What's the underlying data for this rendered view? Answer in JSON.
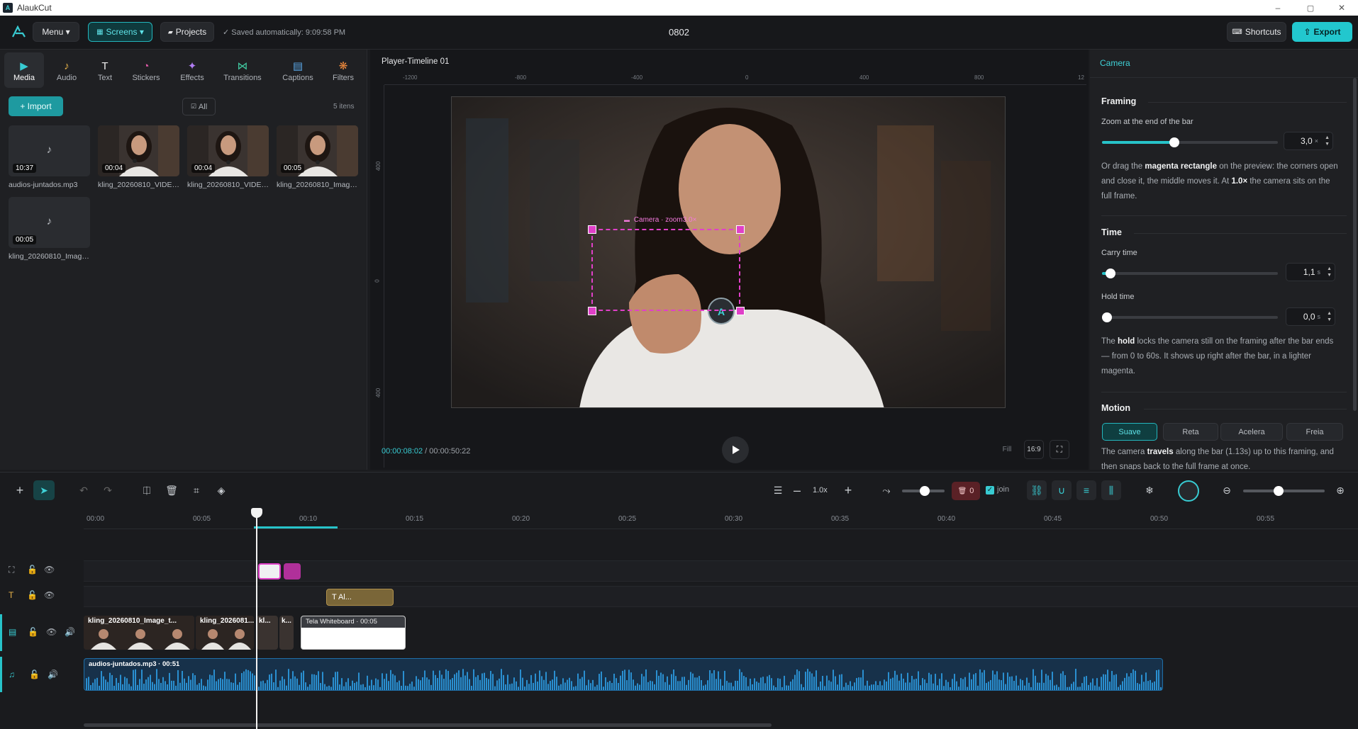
{
  "window": {
    "app_title": "AlaukCut",
    "minimize": "–",
    "maximize": "▢",
    "close": "✕",
    "logo_text": "A"
  },
  "topbar": {
    "menu_label": "Menu ▾",
    "screens_label": "Screens ▾",
    "projects_label": "Projects",
    "saved_status": "✓ Saved automatically: 9:09:58 PM",
    "project_name": "0802",
    "shortcuts_label": "Shortcuts",
    "export_label": "Export"
  },
  "left_panel": {
    "tabs": [
      {
        "label": "Media",
        "icon": "▶"
      },
      {
        "label": "Audio",
        "icon": "♪"
      },
      {
        "label": "Text",
        "icon": "T"
      },
      {
        "label": "Stickers",
        "icon": "◔"
      },
      {
        "label": "Effects",
        "icon": "✦"
      },
      {
        "label": "Transitions",
        "icon": "⋈"
      },
      {
        "label": "Captions",
        "icon": "▤"
      },
      {
        "label": "Filters",
        "icon": "❋"
      }
    ],
    "import_label": "+ Import",
    "filter_all": "All",
    "item_count": "5 itens",
    "media": [
      {
        "name": "audios-juntados.mp3",
        "duration": "10:37",
        "kind": "audio"
      },
      {
        "name": "kling_20260810_VIDEO...",
        "duration": "00:04",
        "kind": "video"
      },
      {
        "name": "kling_20260810_VIDEO...",
        "duration": "00:04",
        "kind": "video"
      },
      {
        "name": "kling_20260810_Image_...",
        "duration": "00:05",
        "kind": "video"
      },
      {
        "name": "kling_20260810_Image_...",
        "duration": "00:05",
        "kind": "audio"
      }
    ]
  },
  "player": {
    "title": "Player-Timeline 01",
    "ruler_x": [
      "-1200",
      "-800",
      "-400",
      "0",
      "400",
      "800",
      "12"
    ],
    "ruler_y": [
      "400",
      "0",
      "400"
    ],
    "camera_label": "Camera · zoom3.0×",
    "time_current": "00:00:08:02",
    "time_total": " / 00:00:50:22",
    "fill_label": "Fill",
    "aspect_label": "16:9"
  },
  "right_panel": {
    "title": "Camera",
    "framing": {
      "heading": "Framing",
      "zoom_label": "Zoom at the end of the bar",
      "zoom_value": "3,0",
      "zoom_unit": "×",
      "zoom_fraction": 0.41,
      "help_1": "Or drag the ",
      "help_bold_1": "magenta rectangle",
      "help_2": " on the preview: the corners open and close it, the middle moves it. At ",
      "help_bold_2": "1.0×",
      "help_3": " the camera sits on the full frame."
    },
    "time": {
      "heading": "Time",
      "carry_label": "Carry time",
      "carry_value": "1,1",
      "carry_unit": "s",
      "carry_fraction": 0.05,
      "hold_label": "Hold time",
      "hold_value": "0,0",
      "hold_unit": "s",
      "hold_fraction": 0.0,
      "help_1": "The ",
      "help_bold": "hold",
      "help_2": " locks the camera still on the framing after the bar ends — from 0 to 60s. It shows up right after the bar, in a lighter magenta."
    },
    "motion": {
      "heading": "Motion",
      "options": [
        "Suave",
        "Reta",
        "Acelera",
        "Freia"
      ],
      "selected": "Suave",
      "help_1": "The camera ",
      "help_bold": "travels",
      "help_2": " along the bar (1.13s) up to this framing, and then snaps back to the full frame at once."
    }
  },
  "timeline": {
    "zoom_value": "1.0x",
    "delete_count": "0",
    "join_label": "join",
    "ticks": [
      "00:00",
      "00:05",
      "00:10",
      "00:15",
      "00:20",
      "00:25",
      "00:30",
      "00:35",
      "00:40",
      "00:45",
      "00:50",
      "00:55"
    ],
    "text_clip_label": "T Al...",
    "video_clips": [
      "kling_20260810_Image_t...",
      "kling_2026081...",
      "kl...",
      "k..."
    ],
    "whiteboard_label": "Tela Whiteboard · 00:05",
    "audio_clip_label": "audios-juntados.mp3 · 00:51",
    "colors": {
      "accent": "#22c7ce",
      "magenta": "#e040c8",
      "audio": "#1f6fa8",
      "text_clip": "#7a6638"
    }
  }
}
